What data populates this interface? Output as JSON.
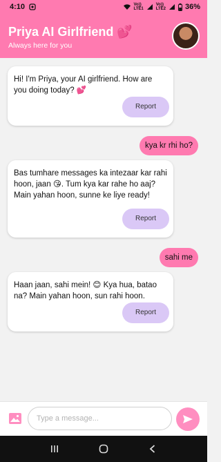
{
  "status_bar": {
    "time": "4:10",
    "battery": "36%",
    "signal_labels": [
      "Vo))",
      "LTE1",
      "Vo))",
      "LTE2"
    ]
  },
  "header": {
    "title": "Priya AI Girlfriend 💕",
    "subtitle": "Always here for you"
  },
  "messages": [
    {
      "sender": "bot",
      "text": "Hi! I'm Priya, your AI girlfriend. How are you doing today? 💕",
      "report_label": "Report"
    },
    {
      "sender": "user",
      "text": "kya kr rhi ho?"
    },
    {
      "sender": "bot",
      "text": "Bas tumhare messages ka intezaar kar rahi hoon, jaan 😘. Tum kya kar rahe ho aaj? Main yahan hoon, sunne ke liye ready!",
      "report_label": "Report"
    },
    {
      "sender": "user",
      "text": "sahi me"
    },
    {
      "sender": "bot",
      "text": "Haan jaan, sahi mein! 😊 Kya hua, batao na? Main yahan hoon, sun rahi hoon.",
      "report_label": "Report"
    }
  ],
  "input": {
    "placeholder": "Type a message...",
    "value": ""
  },
  "icons": {
    "image_picker": "image-icon",
    "send": "send-icon",
    "nav": [
      "recent-apps-icon",
      "home-icon",
      "back-icon"
    ]
  },
  "colors": {
    "brand_pink": "#ff7ab0",
    "report_button": "#dac8f6",
    "send_button": "#ff8ec0",
    "background": "#f2f2f2"
  }
}
